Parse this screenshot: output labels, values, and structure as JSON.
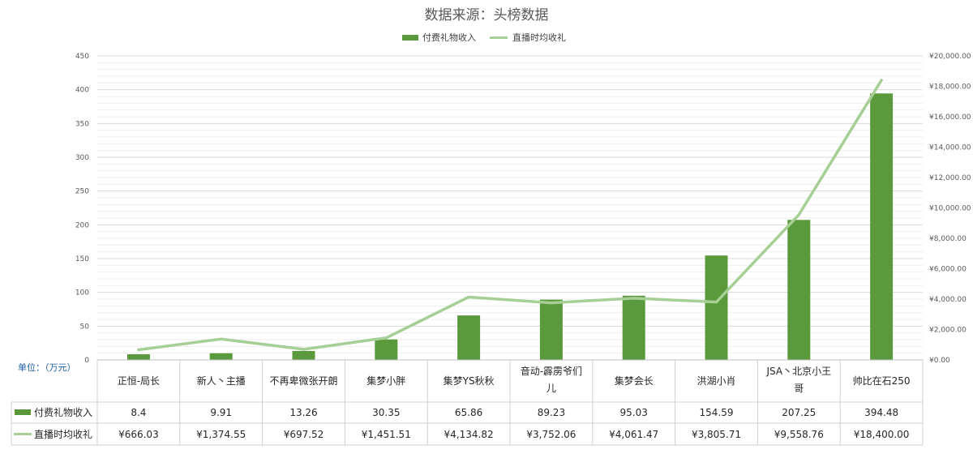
{
  "chart_data": {
    "type": "bar",
    "title": "数据来源：头榜数据",
    "categories": [
      "正恒-局长",
      "新人丶主播",
      "不再卑微张开朗",
      "集梦小胖",
      "集梦YS秋秋",
      "音动-霹雳爷们儿",
      "集梦会长",
      "洪湖小肖",
      "JSA丶北京小王哥",
      "帅比在石250"
    ],
    "series": [
      {
        "name": "付费礼物收入",
        "kind": "bar",
        "axis": "left",
        "color": "#5b9a3c",
        "values": [
          8.4,
          9.91,
          13.26,
          30.35,
          65.86,
          89.23,
          95.03,
          154.59,
          207.25,
          394.48
        ],
        "labels": [
          "8.4",
          "9.91",
          "13.26",
          "30.35",
          "65.86",
          "89.23",
          "95.03",
          "154.59",
          "207.25",
          "394.48"
        ]
      },
      {
        "name": "直播时均收礼",
        "kind": "line",
        "axis": "right",
        "color": "#a6cf96",
        "values": [
          666.03,
          1374.55,
          697.52,
          1451.51,
          4134.82,
          3752.06,
          4061.47,
          3805.71,
          9558.76,
          18400.0
        ],
        "labels": [
          "¥666.03",
          "¥1,374.55",
          "¥697.52",
          "¥1,451.51",
          "¥4,134.82",
          "¥3,752.06",
          "¥4,061.47",
          "¥3,805.71",
          "¥9,558.76",
          "¥18,400.00"
        ]
      }
    ],
    "ylim_left": [
      0,
      450
    ],
    "yticks_left": [
      "0",
      "50",
      "100",
      "150",
      "200",
      "250",
      "300",
      "350",
      "400",
      "450"
    ],
    "ylim_right": [
      0,
      20000
    ],
    "yticks_right": [
      "¥0.00",
      "¥2,000.00",
      "¥4,000.00",
      "¥6,000.00",
      "¥8,000.00",
      "¥10,000.00",
      "¥12,000.00",
      "¥14,000.00",
      "¥16,000.00",
      "¥18,000.00",
      "¥20,000.00"
    ],
    "unit_label": "单位：（万元）",
    "legend_position": "top",
    "grid": true,
    "data_table": true
  }
}
